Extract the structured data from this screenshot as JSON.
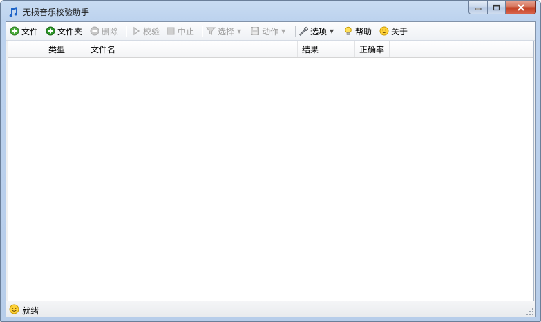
{
  "window": {
    "title": "无损音乐校验助手"
  },
  "toolbar": {
    "file": "文件",
    "folder": "文件夹",
    "delete": "删除",
    "verify": "校验",
    "stop": "中止",
    "select": "选择",
    "action": "动作",
    "options": "选项",
    "help": "帮助",
    "about": "关于"
  },
  "list": {
    "columns": [
      "",
      "类型",
      "文件名",
      "结果",
      "正确率"
    ],
    "rows": []
  },
  "status": {
    "text": "就绪"
  }
}
